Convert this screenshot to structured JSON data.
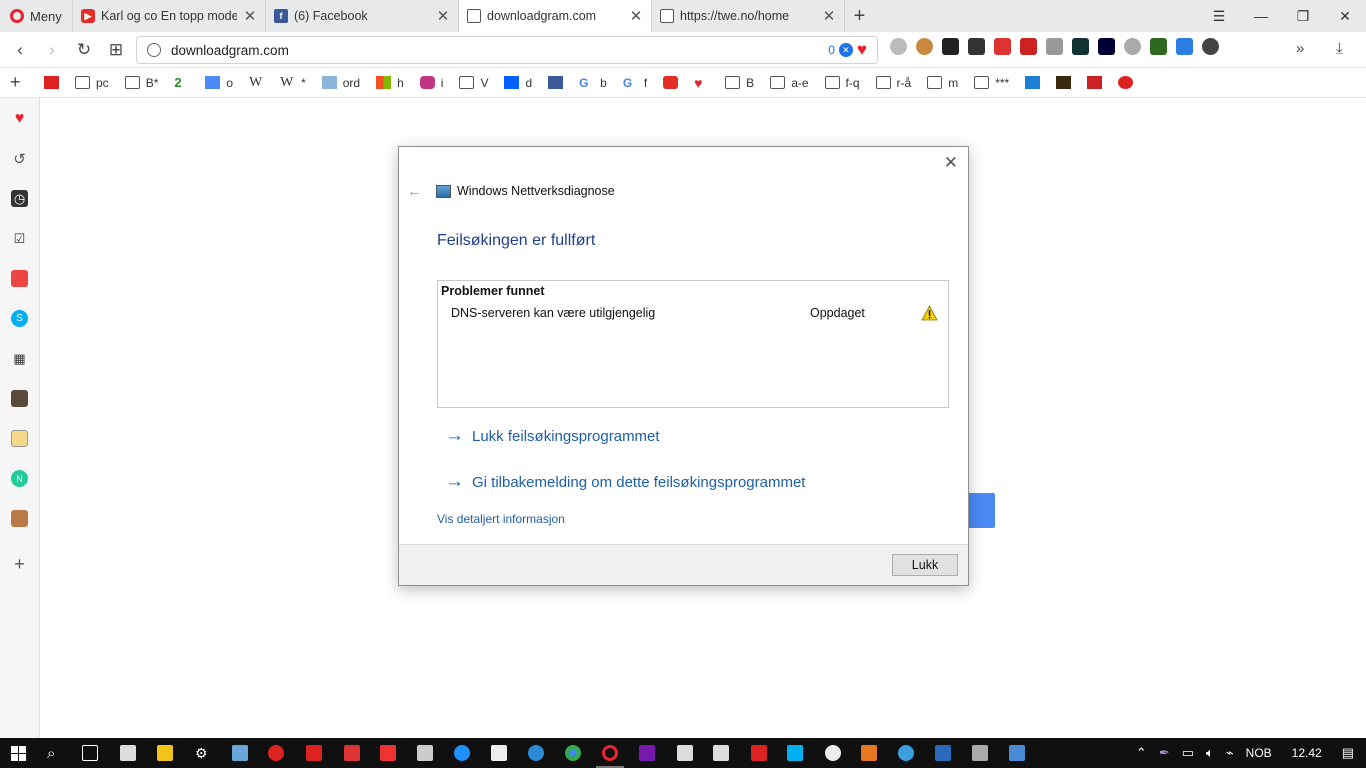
{
  "browser": {
    "menu_label": "Meny",
    "tabs": [
      {
        "title": "Karl og co En topp modell",
        "favicon": "youtube-icon",
        "active": false
      },
      {
        "title": "(6) Facebook",
        "favicon": "facebook-icon",
        "active": false
      },
      {
        "title": "downloadgram.com",
        "favicon": "page-icon",
        "active": true
      },
      {
        "title": "https://twe.no/home",
        "favicon": "page-icon",
        "active": false
      }
    ],
    "url": "downloadgram.com",
    "adblock_count": "0"
  },
  "bookmarks": [
    {
      "label": "",
      "icon": "opera-speed-icon"
    },
    {
      "label": "pc",
      "icon": "folder-icon"
    },
    {
      "label": "B*",
      "icon": "folder-icon"
    },
    {
      "label": "",
      "icon": "two-icon"
    },
    {
      "label": "o",
      "icon": "translate-icon"
    },
    {
      "label": "",
      "icon": "wikipedia-icon"
    },
    {
      "label": "*",
      "icon": "wikipedia-icon"
    },
    {
      "label": "ord",
      "icon": "image-icon"
    },
    {
      "label": "h",
      "icon": "windows-icon"
    },
    {
      "label": "i",
      "icon": "instagram-icon"
    },
    {
      "label": "V",
      "icon": "folder-icon"
    },
    {
      "label": "d",
      "icon": "dropbox-icon"
    },
    {
      "label": "",
      "icon": "facebook-icon"
    },
    {
      "label": "b",
      "icon": "google-icon"
    },
    {
      "label": "f",
      "icon": "google-icon"
    },
    {
      "label": "",
      "icon": "youtube-icon"
    },
    {
      "label": "",
      "icon": "heart-icon"
    },
    {
      "label": "B",
      "icon": "folder-icon"
    },
    {
      "label": "a-e",
      "icon": "folder-icon"
    },
    {
      "label": "f-q",
      "icon": "folder-icon"
    },
    {
      "label": "r-å",
      "icon": "folder-icon"
    },
    {
      "label": "m",
      "icon": "folder-icon"
    },
    {
      "label": "***",
      "icon": "folder-icon"
    }
  ],
  "dialog": {
    "app_title": "Windows Nettverksdiagnose",
    "heading": "Feilsøkingen er fullført",
    "problems_header": "Problemer funnet",
    "problem": {
      "name": "DNS-serveren kan være utilgjengelig",
      "status": "Oppdaget"
    },
    "actions": [
      "Lukk feilsøkingsprogrammet",
      "Gi tilbakemelding om dette feilsøkingsprogrammet"
    ],
    "detail_link": "Vis detaljert informasjon",
    "close_button": "Lukk"
  },
  "taskbar": {
    "language": "NOB",
    "time": "12.42"
  },
  "colors": {
    "accent_link": "#1e5faa",
    "heading": "#213f8f",
    "opera_red": "#e8232e",
    "taskbar": "#101010"
  }
}
